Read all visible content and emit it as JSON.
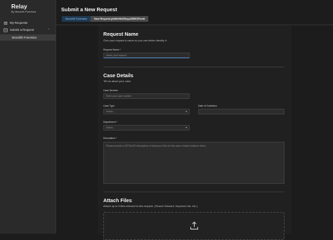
{
  "app": {
    "name": "Relay",
    "org": "By Monolith Forensics"
  },
  "sidebar": {
    "items": [
      {
        "label": "My Requests",
        "icon": "list-icon"
      },
      {
        "label": "Submit a Request",
        "icon": "submit-icon"
      }
    ],
    "sub_item": "Monolith Forensics"
  },
  "page": {
    "title": "Submit a New Request",
    "tabs": [
      {
        "label": "Monolith Forensics",
        "active": false
      },
      {
        "label": "New Request pbWnHhWSsyzZ8RIOFhmK",
        "active": true
      }
    ]
  },
  "sections": {
    "name": {
      "title": "Request Name",
      "subtitle": "Give your request a name so you can better identify it.",
      "label": "Request Name *",
      "placeholder": "Name your request"
    },
    "case": {
      "title": "Case Details",
      "subtitle": "Tell us about your case.",
      "case_number_label": "Case Number",
      "case_number_placeholder": "Enter your case number",
      "case_type_label": "Case Type",
      "case_type_value": "Select...",
      "date_label": "Date of Collection",
      "department_label": "Department *",
      "department_value": "Select...",
      "description_label": "Description *",
      "description_placeholder": "Please provide a DETAILED description of what you'd like for this case in listed evidence items."
    },
    "files": {
      "title": "Attach Files",
      "subtitle": "Attach up to 5 files relevant to this request. (Search Warrant, Keyword List, etc.)"
    }
  },
  "colors": {
    "background": "#1c1c1c",
    "sidebar": "#2a2a2a",
    "accent": "#5a8fd0",
    "tab_inactive": "#1f3a54"
  }
}
